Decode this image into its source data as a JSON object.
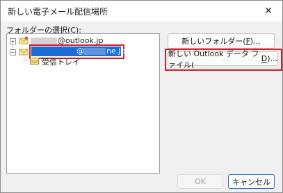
{
  "window": {
    "title": "新しい電子メール配信場所",
    "close_glyph": "✕"
  },
  "folder_select": {
    "label_prefix": "フォルダーの選択(",
    "label_accel": "C",
    "label_suffix": "):"
  },
  "tree": {
    "account1": {
      "visible_text": "@outlook.jp",
      "expander": "+"
    },
    "account2": {
      "visible_at": "@",
      "visible_domain": "ne.jp",
      "expander": "−"
    },
    "inbox": {
      "label": "受信トレイ"
    }
  },
  "buttons": {
    "new_folder": {
      "prefix": "新しいフォルダー(",
      "accel": "F",
      "suffix": ")..."
    },
    "new_data_file": {
      "prefix": "新しい Outlook データ ファイル(",
      "accel": "D",
      "suffix": ")..."
    },
    "ok": "OK",
    "cancel": "キャンセル"
  },
  "colors": {
    "highlight_red": "#d01f2a",
    "selection_blue": "#1a6fd6"
  }
}
